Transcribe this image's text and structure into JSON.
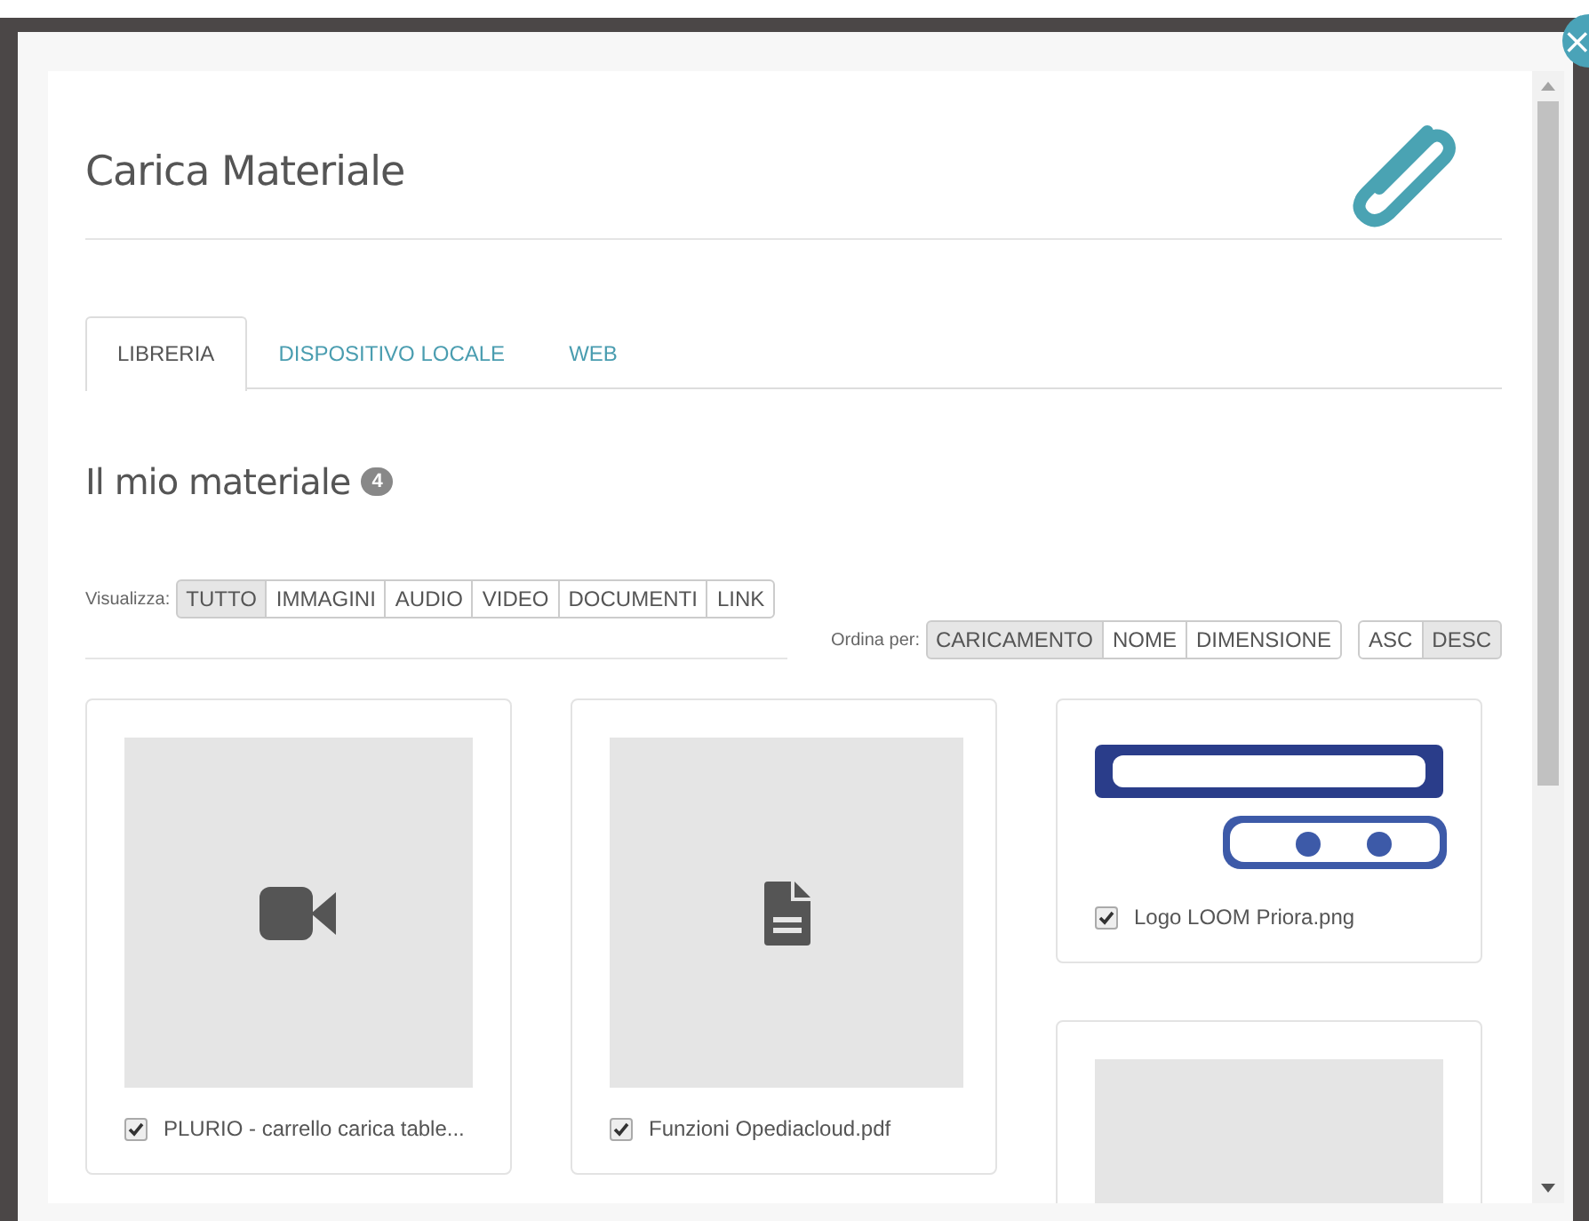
{
  "close": "×",
  "title": "Carica Materiale",
  "tabs": [
    {
      "label": "LIBRERIA",
      "selected": true
    },
    {
      "label": "DISPOSITIVO LOCALE",
      "selected": false
    },
    {
      "label": "WEB",
      "selected": false
    }
  ],
  "section": {
    "title": "Il mio materiale",
    "count": "4"
  },
  "filter": {
    "label": "Visualizza:",
    "options": [
      {
        "label": "TUTTO",
        "selected": true
      },
      {
        "label": "IMMAGINI",
        "selected": false
      },
      {
        "label": "AUDIO",
        "selected": false
      },
      {
        "label": "VIDEO",
        "selected": false
      },
      {
        "label": "DOCUMENTI",
        "selected": false
      },
      {
        "label": "LINK",
        "selected": false
      }
    ]
  },
  "sort": {
    "label": "Ordina per:",
    "fields": [
      {
        "label": "CARICAMENTO",
        "selected": true
      },
      {
        "label": "NOME",
        "selected": false
      },
      {
        "label": "DIMENSIONE",
        "selected": false
      }
    ],
    "directions": [
      {
        "label": "ASC",
        "selected": false
      },
      {
        "label": "DESC",
        "selected": true
      }
    ]
  },
  "columns": [
    [
      {
        "kind": "video",
        "name": "PLURIO - carrello carica table...",
        "checked": true
      }
    ],
    [
      {
        "kind": "document",
        "name": "Funzioni Opediacloud.pdf",
        "checked": true
      }
    ],
    [
      {
        "kind": "picture",
        "name": "Logo LOOM Priora.png",
        "checked": true
      },
      {
        "kind": "blank"
      }
    ]
  ]
}
